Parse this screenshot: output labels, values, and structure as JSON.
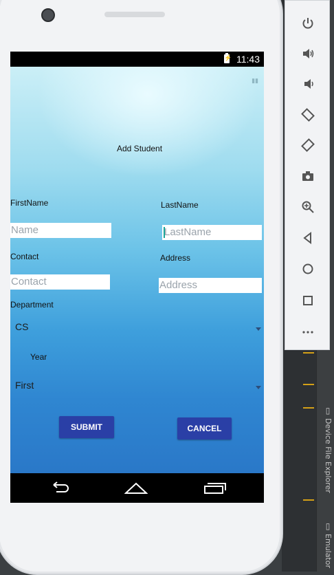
{
  "status_bar": {
    "time": "11:43",
    "battery_icon": "battery-charging-icon"
  },
  "app": {
    "title": "Add Student",
    "first_name": {
      "label": "FirstName",
      "placeholder": "Name"
    },
    "last_name": {
      "label": "LastName",
      "placeholder": "LastName"
    },
    "contact": {
      "label": "Contact",
      "placeholder": "Contact"
    },
    "address": {
      "label": "Address",
      "placeholder": "Address"
    },
    "department": {
      "label": "Department",
      "selected": "CS"
    },
    "year": {
      "label": "Year",
      "selected": "First"
    },
    "submit_label": "SUBMIT",
    "cancel_label": "CANCEL",
    "colors": {
      "button": "#2a3fa6",
      "gradient_top": "#cbeff7",
      "gradient_bottom": "#2a78c8"
    }
  },
  "nav_bar": {
    "icons": [
      "back-icon",
      "home-icon",
      "recents-icon"
    ]
  },
  "emulator_toolbar": {
    "icons": [
      "power-icon",
      "volume-up-icon",
      "volume-down-icon",
      "rotate-left-icon",
      "rotate-right-icon",
      "camera-icon",
      "zoom-icon",
      "back-icon",
      "home-icon",
      "overview-icon",
      "more-icon"
    ]
  },
  "ide_side_tabs": {
    "device_file_explorer": "Device File Explorer",
    "emulator": "Emulator"
  }
}
